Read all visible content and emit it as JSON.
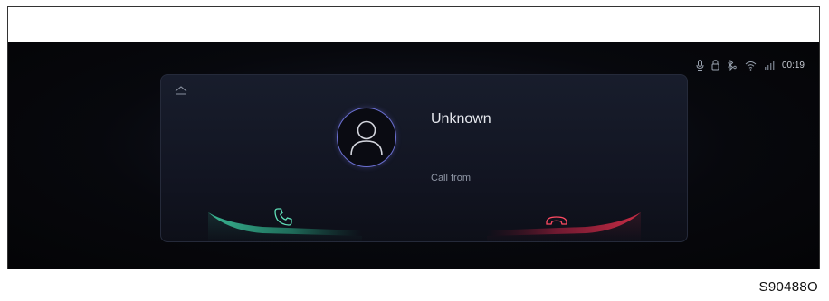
{
  "status_bar": {
    "icons": [
      "microphone-icon",
      "lock-icon",
      "bluetooth-icon",
      "wifi-icon",
      "signal-icon"
    ],
    "time": "00:19"
  },
  "call": {
    "caller_name": "Unknown",
    "call_label": "Call from",
    "answer_color": "#3fc9a0",
    "decline_color": "#e0304a"
  },
  "figure_code": "S90488O"
}
